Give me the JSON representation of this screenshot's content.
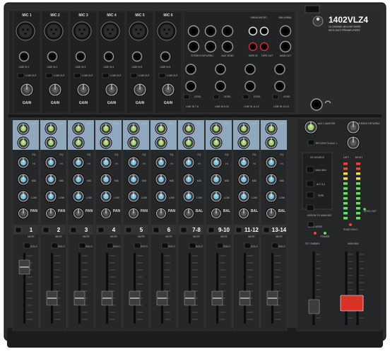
{
  "brand": {
    "model": "1402VLZ4",
    "line1": "14-CHANNEL MIC/LINE MIXER",
    "line2": "WITH ONYX PREAMPLIFIERS"
  },
  "mic_inputs": [
    {
      "label": "MIC 1",
      "line": "LINE IN 1"
    },
    {
      "label": "MIC 2",
      "line": "LINE IN 2"
    },
    {
      "label": "MIC 3",
      "line": "LINE IN 3"
    },
    {
      "label": "MIC 4",
      "line": "LINE IN 4"
    },
    {
      "label": "MIC 5",
      "line": "LINE IN 5"
    },
    {
      "label": "MIC 6",
      "line": "LINE IN 6"
    }
  ],
  "mic_knob_label": "GAIN",
  "mic_switch_label": "LOW CUT",
  "patch": {
    "stereo_returns": "STEREO RETURNS",
    "aux_sends": "AUX SEND",
    "unbalanced": "UNBALANCED",
    "tape_in": "TAPE IN",
    "tape_out": "TAPE OUT",
    "main_out": "MAIN OUT",
    "bal_unbal": "BAL/UNBAL",
    "line_pairs": [
      "LINE IN 7-8",
      "LINE IN 9-10",
      "LINE IN 11-12",
      "LINE IN 13-14"
    ],
    "level_label": "LEVEL"
  },
  "channels": [
    {
      "num": "1",
      "pan": "PAN"
    },
    {
      "num": "2",
      "pan": "PAN"
    },
    {
      "num": "3",
      "pan": "PAN"
    },
    {
      "num": "4",
      "pan": "PAN"
    },
    {
      "num": "5",
      "pan": "PAN"
    },
    {
      "num": "6",
      "pan": "PAN"
    },
    {
      "num": "7-8",
      "pan": "BAL"
    },
    {
      "num": "9-10",
      "pan": "BAL"
    },
    {
      "num": "11-12",
      "pan": "BAL"
    },
    {
      "num": "13-14",
      "pan": "BAL"
    }
  ],
  "strip_labels": {
    "aux": "AUX",
    "eq": "EQ",
    "hi": "HI",
    "mid": "MID",
    "low": "LOW",
    "mute": "MUTE",
    "alt": "ALT 3-4",
    "solo": "SOLO"
  },
  "master": {
    "aux1_master": "AUX 1 MASTER",
    "stereo_returns": "STEREO RETURNS",
    "return_to_aux1": "RETURN TO AUX 1",
    "cr_source": "CR SOURCE",
    "main_mix": "MAIN MIX",
    "alt34": "ALT 3-4",
    "tape": "TAPE",
    "assign_to_main": "ASSIGN TO MAIN MIX",
    "solo_mode": "SOLO MODE",
    "left": "LEFT",
    "right": "RIGHT",
    "level_set": "LEVEL SET",
    "rude_solo": "RUDE SOLO",
    "power": "POWER",
    "cr_submix": "CR / SUBMIX",
    "main_mix_fader": "MAIN MIX"
  },
  "colors": {
    "body": "#2b2c2e",
    "panel": "#1f2021",
    "blue_strip": "#8fa8bd",
    "knob_ring": "#d8d8d8",
    "knob_green": "#9fcf6a",
    "knob_blue": "#7ec8e8",
    "led_green": "#63e35b",
    "led_yellow": "#f0d94a",
    "led_red": "#ff3b30"
  }
}
